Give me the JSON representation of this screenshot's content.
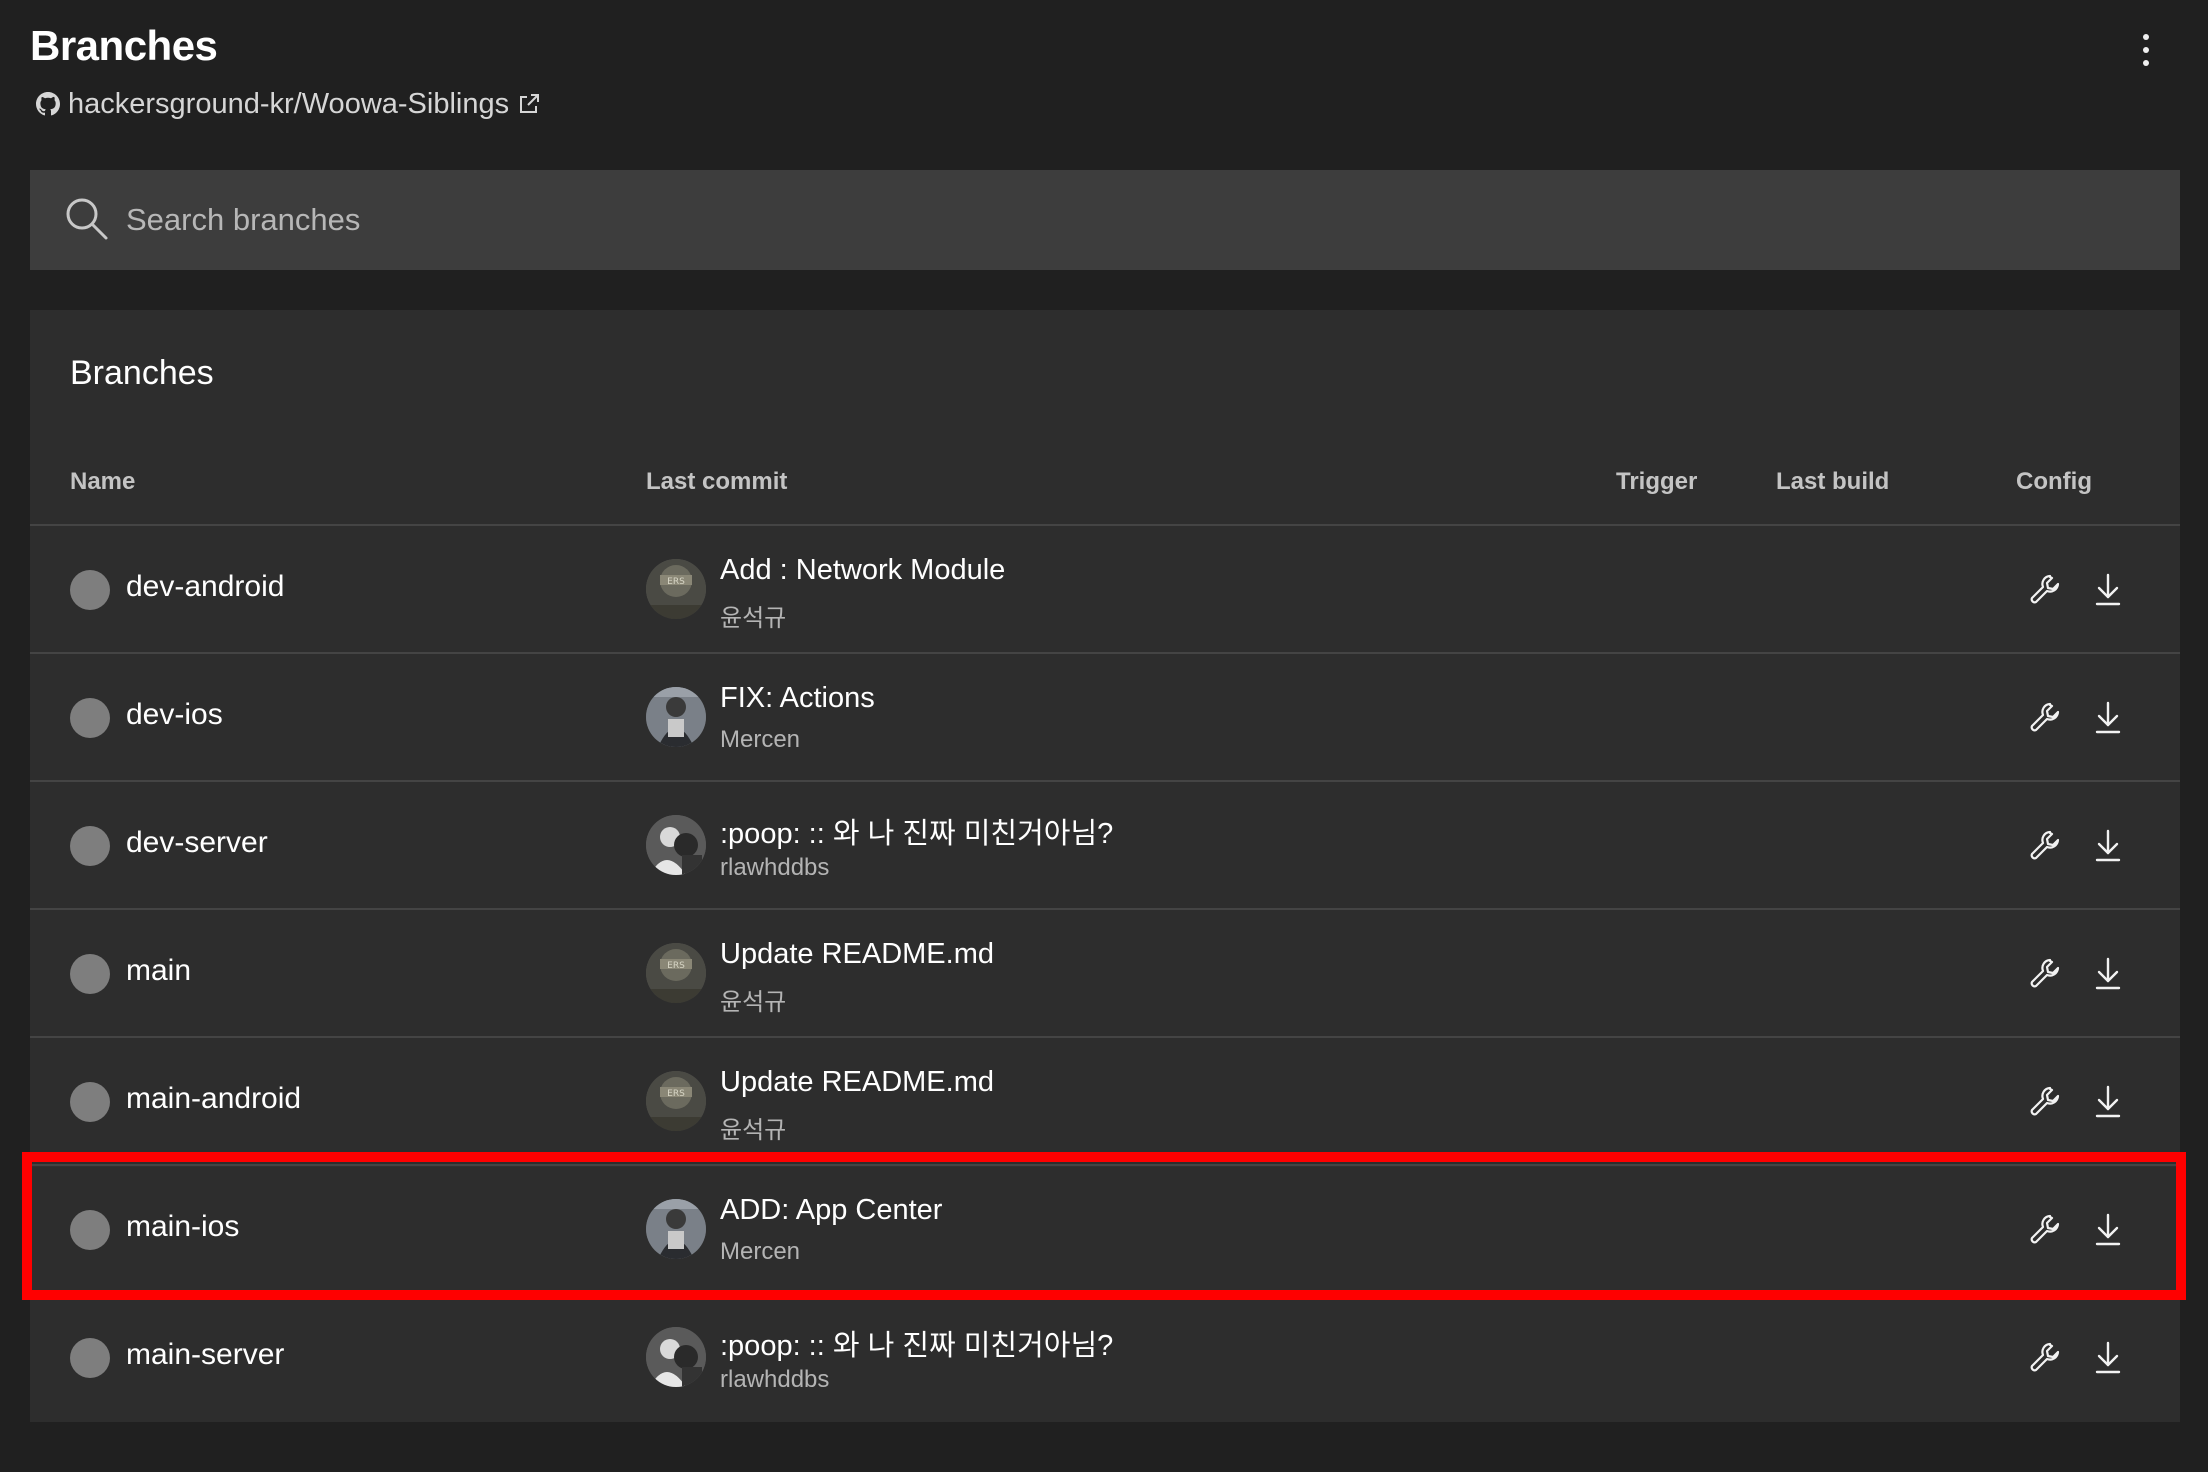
{
  "header": {
    "title": "Branches",
    "repo": "hackersground-kr/Woowa-Siblings"
  },
  "search": {
    "placeholder": "Search branches",
    "value": ""
  },
  "panel": {
    "title": "Branches",
    "columns": {
      "name": "Name",
      "last_commit": "Last commit",
      "trigger": "Trigger",
      "last_build": "Last build",
      "config": "Config"
    }
  },
  "branches": [
    {
      "name": "dev-android",
      "commit": "Add : Network Module",
      "author": "윤석규",
      "avatar": "avatar-ers"
    },
    {
      "name": "dev-ios",
      "commit": "FIX: Actions",
      "author": "Mercen",
      "avatar": "avatar-mercen"
    },
    {
      "name": "dev-server",
      "commit": ":poop: :: 와 나 진짜 미친거아님?",
      "author": "rlawhddbs",
      "avatar": "avatar-rlawhddbs"
    },
    {
      "name": "main",
      "commit": "Update README.md",
      "author": "윤석규",
      "avatar": "avatar-ers"
    },
    {
      "name": "main-android",
      "commit": "Update README.md",
      "author": "윤석규",
      "avatar": "avatar-ers"
    },
    {
      "name": "main-ios",
      "commit": "ADD: App Center",
      "author": "Mercen",
      "avatar": "avatar-mercen",
      "highlighted": true
    },
    {
      "name": "main-server",
      "commit": ":poop: :: 와 나 진짜 미친거아님?",
      "author": "rlawhddbs",
      "avatar": "avatar-rlawhddbs"
    }
  ],
  "colors": {
    "background": "#202020",
    "panel": "#2d2d2d",
    "search": "#3d3d3d",
    "status_dot": "#7e7e7e",
    "highlight": "#ff0000"
  }
}
